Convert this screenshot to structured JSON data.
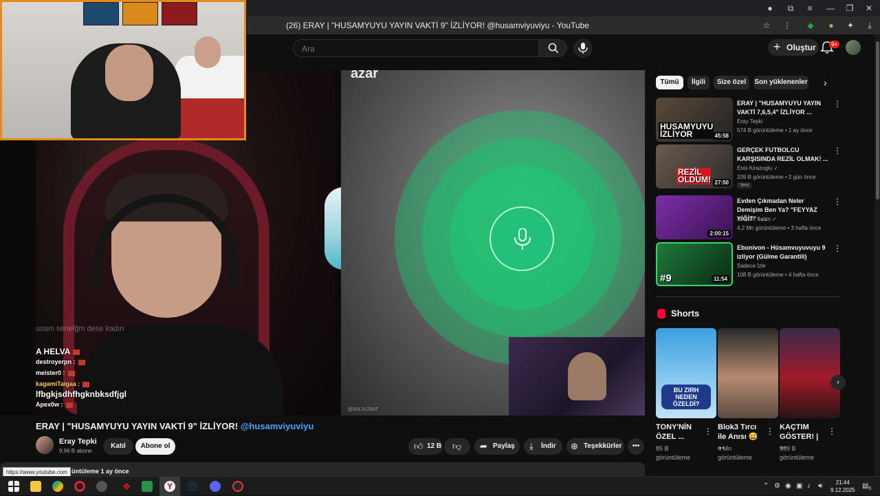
{
  "browser": {
    "window_title": "(26) ERAY | \"HUSAMYUYU YAYIN VAKTİ 9\" İZLİYOR! @husamviyuviyu - YouTube"
  },
  "masthead": {
    "search_placeholder": "Ara",
    "create_label": "Oluştur",
    "notification_count": "9+"
  },
  "video": {
    "overlay_text_left": "azar",
    "chat": [
      {
        "user": "A HELVA",
        "big": true
      },
      {
        "user": "destroyerpn :",
        "big": false
      },
      {
        "user": "meister0 :",
        "big": false
      },
      {
        "user": "kagamiTaigaa :",
        "big": false
      },
      {
        "user": "lfbgkjsdhfhgknbksdfjgl",
        "big": true
      },
      {
        "user": "Apex0w :",
        "big": false
      }
    ],
    "chat_faded": "usam  senelğm dese kadın",
    "inset_watermark": "@S0L31Z6AT",
    "title_main": "ERAY | \"HUSAMYUYU YAYIN VAKTİ 9\" İZLİYOR! ",
    "title_tag": "@husamviyuviyu",
    "channel_name": "Eray Tepki",
    "subscribers": "9,96 B abone",
    "join_label": "Katıl",
    "subscribe_label": "Abone ol",
    "likes": "12 B",
    "share_label": "Paylaş",
    "download_label": "İndir",
    "thanks_label": "Teşekkürler",
    "description_meta": "üntüleme  1 ay önce",
    "status_url": "https://www.youtube.com"
  },
  "chips": [
    "Tümü",
    "İlgili",
    "Size özel",
    "Son yüklenenler"
  ],
  "recommendations": [
    {
      "title": "ERAY | \"HUSAMYUYU YAYIN VAKTİ 7,6,5,4\" İZLİYOR ...",
      "channel": "Eray Tepki",
      "meta": "574 B görüntüleme • 1 ay önce",
      "duration": "45:58",
      "thumb_text": "HUSAMYUYU İZLİYOR",
      "new": ""
    },
    {
      "title": "GERÇEK FUTBOLCU KARŞISINDA REZİL OLMAK! ...",
      "channel": "Enis Kirazoglu ✓",
      "meta": "339 B görüntüleme • 2 gün önce",
      "duration": "27:50",
      "thumb_text": "REZİL OLDUM!",
      "new": "Yeni"
    },
    {
      "title": "Evden Çıkmadan Neler Demişim Ben Ya? \"FEYYAZ YİĞİT\" - ...",
      "channel": "İbrahim Selim ✓",
      "meta": "4,2 Mn görüntüleme • 3 hafta önce",
      "duration": "2:00:15",
      "thumb_text": "",
      "new": ""
    },
    {
      "title": "Ebonivon - Hüsamvuyuvuyu 9 izliyor (Gülme Garantili)",
      "channel": "Sadece İzle",
      "meta": "108 B görüntüleme • 4 hafta önce",
      "duration": "11:54",
      "thumb_text": "#9",
      "new": ""
    }
  ],
  "shorts": {
    "header": "Shorts",
    "items": [
      {
        "title": "TONY'NİN ÖZEL ...",
        "views": "85 B görüntüleme",
        "thumb_text": "BU ZIRH NEDEN ÖZELDİ?"
      },
      {
        "title": "Blok3 Tırcı ile Anısı 😅 ...",
        "views": "4 Mn görüntüleme",
        "thumb_text": ""
      },
      {
        "title": "KAÇTIM GÖSTER! | ...",
        "views": "339 B görüntüleme",
        "thumb_text": ""
      }
    ]
  },
  "taskbar": {
    "time": "21:44",
    "date": "9.12.2025",
    "notif_count": "5"
  },
  "colors": {
    "accent_orange": "#e58b1e",
    "youtube_red": "#ff0033",
    "mic_green": "#22c07a",
    "link_blue": "#3ea6ff"
  }
}
